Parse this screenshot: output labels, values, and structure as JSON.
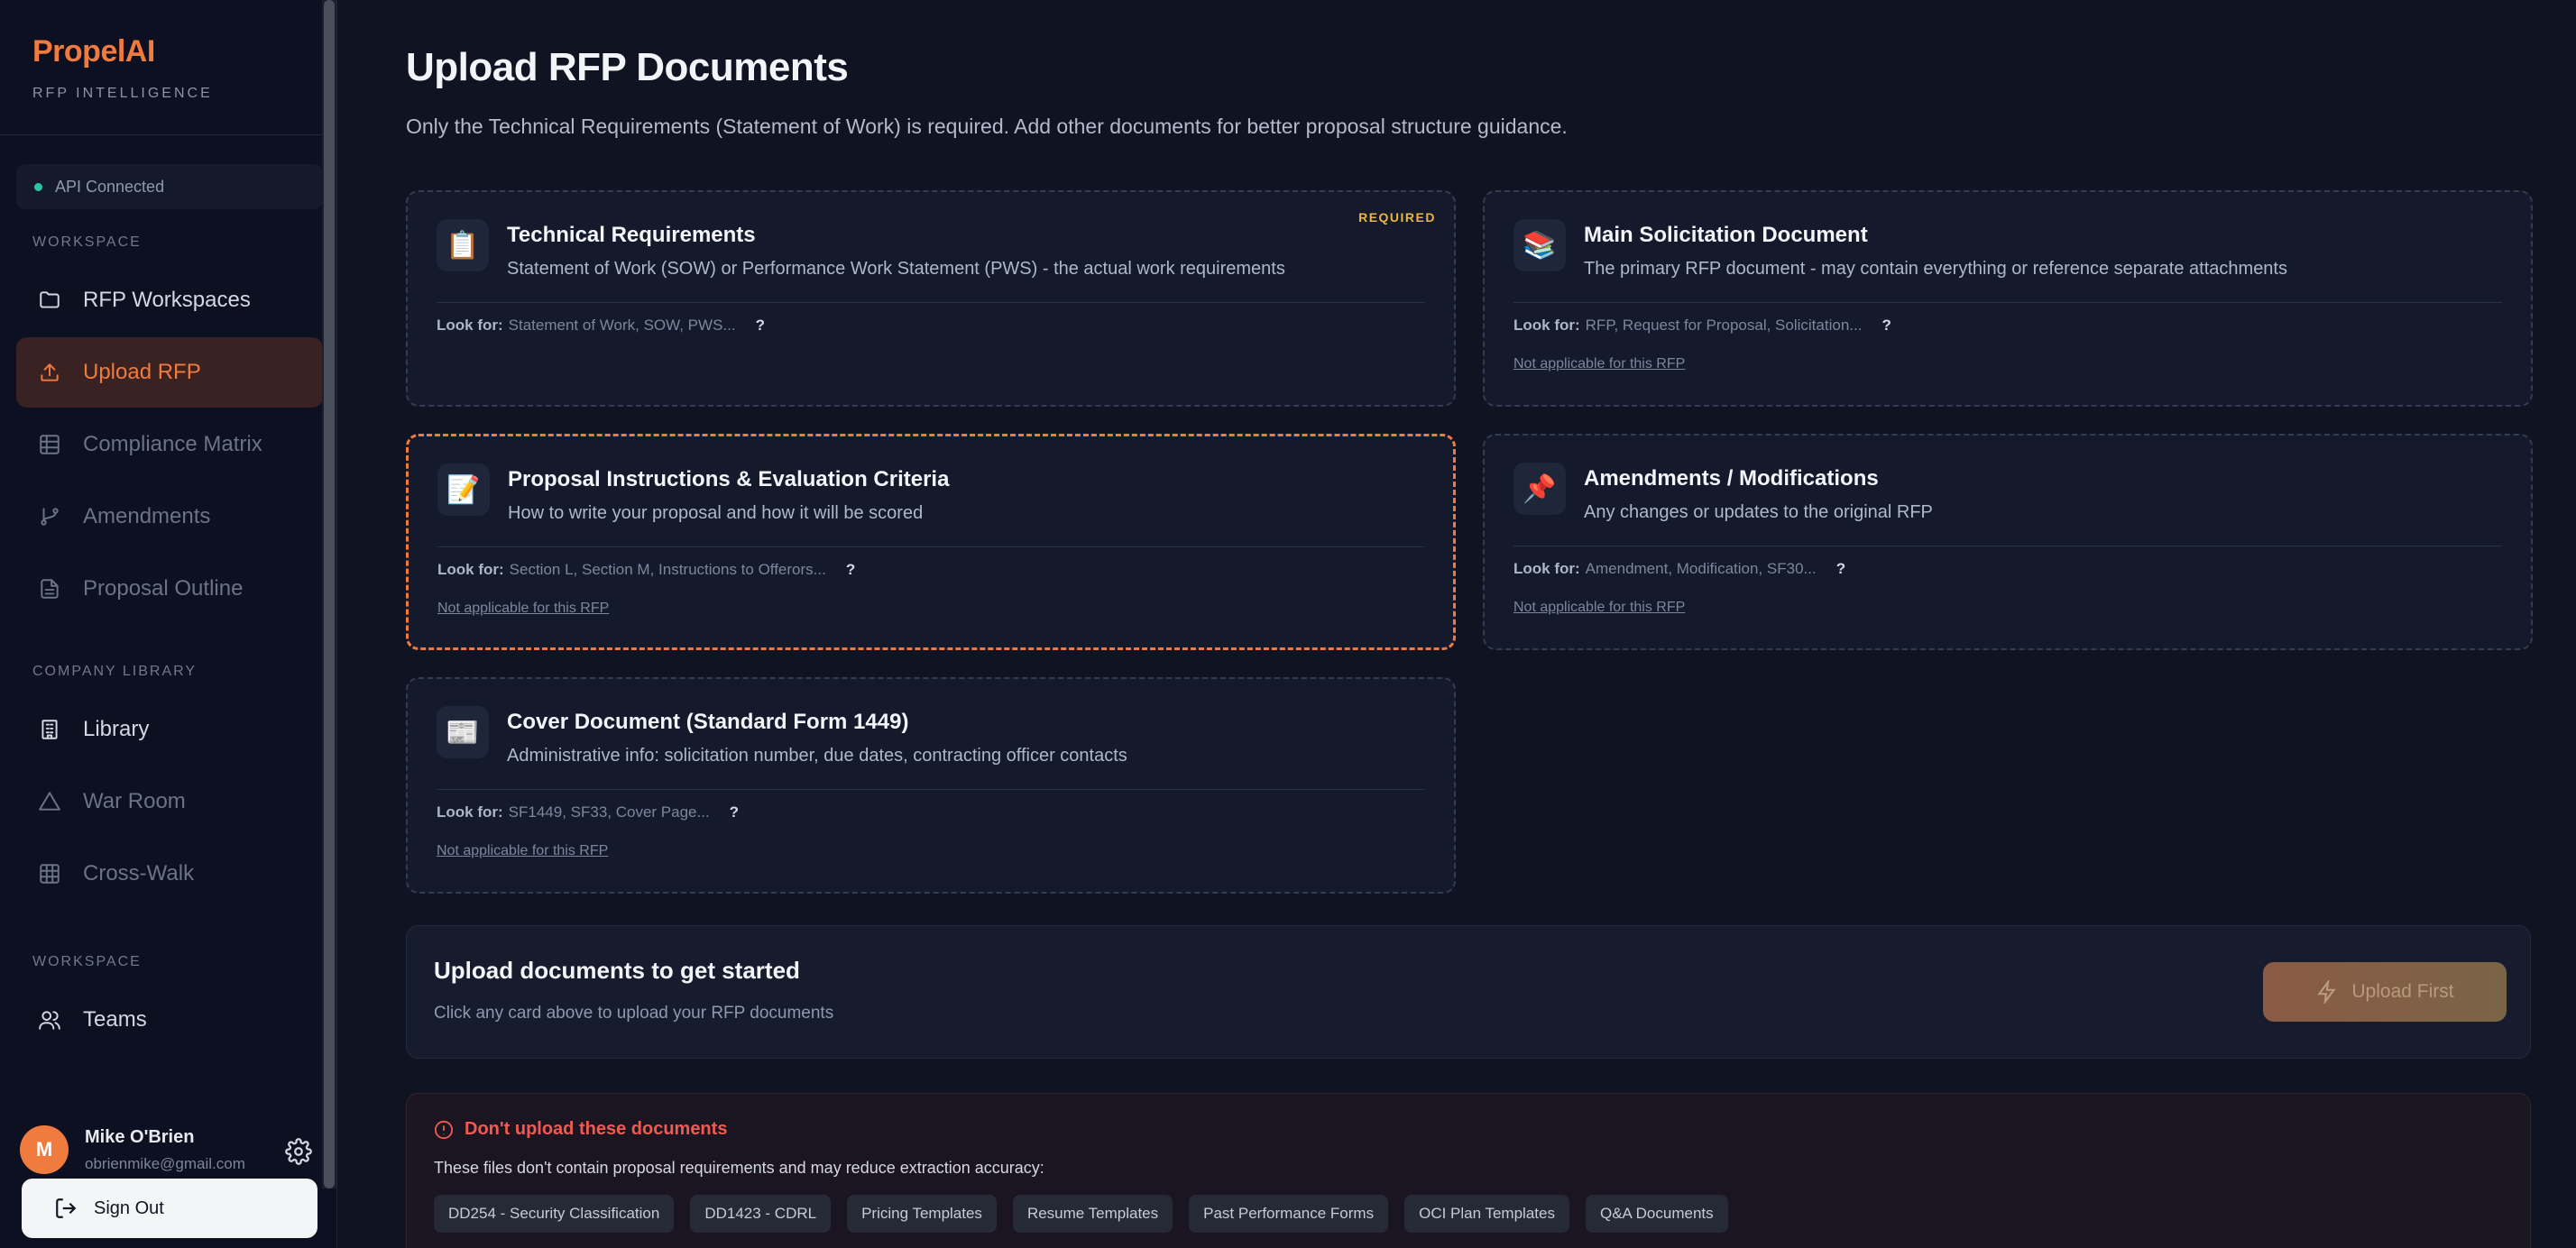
{
  "brand": {
    "name": "PropelAI",
    "subtitle": "RFP INTELLIGENCE"
  },
  "api_status": "API Connected",
  "sidebar": {
    "sections": [
      {
        "label": "WORKSPACE"
      },
      {
        "label": "COMPANY LIBRARY"
      },
      {
        "label": "WORKSPACE"
      }
    ],
    "items": [
      {
        "label": "RFP Workspaces",
        "icon": "folder-icon"
      },
      {
        "label": "Upload RFP",
        "icon": "upload-icon",
        "active": true
      },
      {
        "label": "Compliance Matrix",
        "icon": "grid-icon"
      },
      {
        "label": "Amendments",
        "icon": "git-branch-icon"
      },
      {
        "label": "Proposal Outline",
        "icon": "document-icon"
      },
      {
        "label": "Library",
        "icon": "building-icon"
      },
      {
        "label": "War Room",
        "icon": "triangle-icon"
      },
      {
        "label": "Cross-Walk",
        "icon": "grid-icon"
      },
      {
        "label": "Teams",
        "icon": "users-icon"
      }
    ]
  },
  "user": {
    "initial": "M",
    "name": "Mike O'Brien",
    "email": "obrienmike@gmail.com"
  },
  "signout_label": "Sign Out",
  "page": {
    "title": "Upload RFP Documents",
    "subtitle": "Only the Technical Requirements (Statement of Work) is required. Add other documents for better proposal structure guidance."
  },
  "cards": [
    {
      "icon": "📋",
      "title": "Technical Requirements",
      "desc": "Statement of Work (SOW) or Performance Work Statement (PWS) - the actual work requirements",
      "look_for_label": "Look for:",
      "look_for": "Statement of Work, SOW, PWS...",
      "help": "?",
      "badge": "REQUIRED"
    },
    {
      "icon": "📚",
      "title": "Main Solicitation Document",
      "desc": "The primary RFP document - may contain everything or reference separate attachments",
      "look_for_label": "Look for:",
      "look_for": "RFP, Request for Proposal, Solicitation...",
      "help": "?",
      "na": "Not applicable for this RFP"
    },
    {
      "icon": "📝",
      "title": "Proposal Instructions & Evaluation Criteria",
      "desc": "How to write your proposal and how it will be scored",
      "look_for_label": "Look for:",
      "look_for": "Section L, Section M, Instructions to Offerors...",
      "help": "?",
      "na": "Not applicable for this RFP"
    },
    {
      "icon": "📌",
      "title": "Amendments / Modifications",
      "desc": "Any changes or updates to the original RFP",
      "look_for_label": "Look for:",
      "look_for": "Amendment, Modification, SF30...",
      "help": "?",
      "na": "Not applicable for this RFP"
    },
    {
      "icon": "📰",
      "title": "Cover Document (Standard Form 1449)",
      "desc": "Administrative info: solicitation number, due dates, contracting officer contacts",
      "look_for_label": "Look for:",
      "look_for": "SF1449, SF33, Cover Page...",
      "help": "?",
      "na": "Not applicable for this RFP"
    }
  ],
  "upload": {
    "title": "Upload documents to get started",
    "subtitle": "Click any card above to upload your RFP documents",
    "button": "Upload First"
  },
  "warning": {
    "title": "Don't upload these documents",
    "subtitle": "These files don't contain proposal requirements and may reduce extraction accuracy:",
    "chips": [
      "DD254 - Security Classification",
      "DD1423 - CDRL",
      "Pricing Templates",
      "Resume Templates",
      "Past Performance Forms",
      "OCI Plan Templates",
      "Q&A Documents"
    ]
  },
  "colors": {
    "accent": "#f07b3f",
    "required": "#e8b540",
    "danger": "#ef5b52",
    "status_ok": "#2ec4a3"
  }
}
